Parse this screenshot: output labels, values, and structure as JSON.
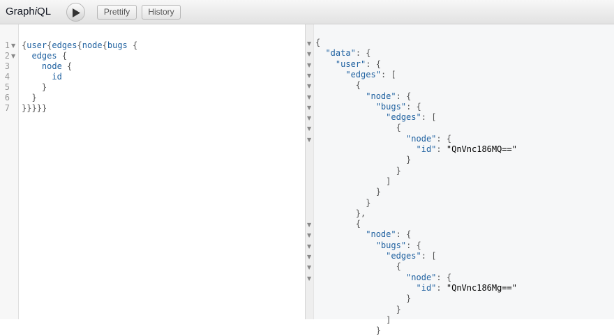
{
  "toolbar": {
    "brand_prefix": "Graph",
    "brand_italic": "i",
    "brand_suffix": "QL",
    "prettify_label": "Prettify",
    "history_label": "History"
  },
  "query_editor": {
    "line_numbers": [
      "1",
      "2",
      "3",
      "4",
      "5",
      "6",
      "7"
    ],
    "lines": [
      "{user{edges{node{bugs {",
      "  edges {",
      "    node {",
      "      id",
      "    }",
      "  }",
      "}}}}}"
    ]
  },
  "result_viewer": {
    "lines": [
      "{",
      "  \"data\": {",
      "    \"user\": {",
      "      \"edges\": [",
      "        {",
      "          \"node\": {",
      "            \"bugs\": {",
      "              \"edges\": [",
      "                {",
      "                  \"node\": {",
      "                    \"id\": \"QnVnc186MQ==\"",
      "                  }",
      "                }",
      "              ]",
      "            }",
      "          }",
      "        },",
      "        {",
      "          \"node\": {",
      "            \"bugs\": {",
      "              \"edges\": [",
      "                {",
      "                  \"node\": {",
      "                    \"id\": \"QnVnc186Mg==\"",
      "                  }",
      "                }",
      "              ]",
      "            }"
    ]
  },
  "colors": {
    "keyword": "#1f61a0",
    "string": "#d64292",
    "punctuation": "#555555"
  }
}
